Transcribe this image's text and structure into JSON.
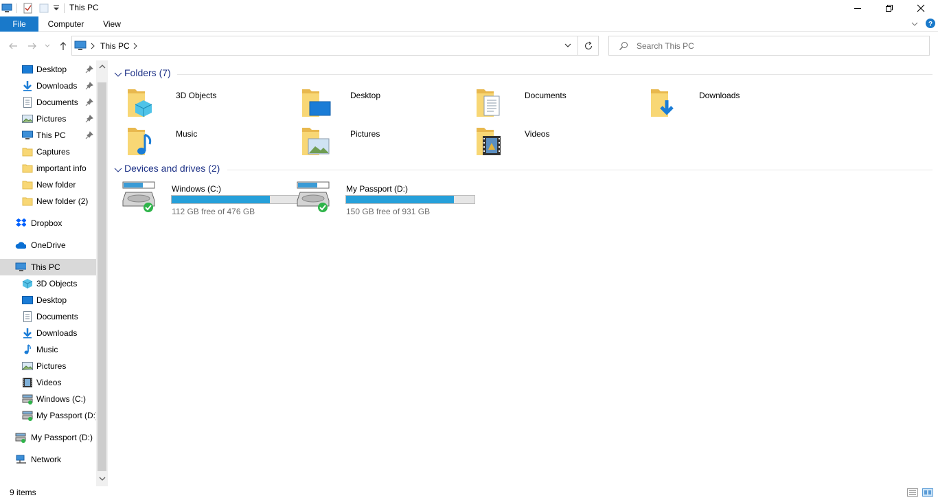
{
  "window": {
    "title": "This PC"
  },
  "ribbon": {
    "tabs": [
      {
        "label": "File"
      },
      {
        "label": "Computer"
      },
      {
        "label": "View"
      }
    ]
  },
  "address": {
    "segments": [
      "This PC"
    ]
  },
  "search": {
    "placeholder": "Search This PC"
  },
  "sidebar": {
    "quick_access": [
      {
        "label": "Desktop",
        "icon": "desktop-icon",
        "pinned": true
      },
      {
        "label": "Downloads",
        "icon": "downloads-icon",
        "pinned": true
      },
      {
        "label": "Documents",
        "icon": "documents-icon",
        "pinned": true
      },
      {
        "label": "Pictures",
        "icon": "pictures-icon",
        "pinned": true
      },
      {
        "label": "This PC",
        "icon": "computer-icon",
        "pinned": true
      },
      {
        "label": "Captures",
        "icon": "folder-icon",
        "pinned": false
      },
      {
        "label": "important info",
        "icon": "folder-icon",
        "pinned": false
      },
      {
        "label": "New folder",
        "icon": "folder-icon",
        "pinned": false
      },
      {
        "label": "New folder (2)",
        "icon": "folder-icon",
        "pinned": false
      }
    ],
    "dropbox": "Dropbox",
    "onedrive": "OneDrive",
    "this_pc": "This PC",
    "this_pc_children": [
      {
        "label": "3D Objects",
        "icon": "3d-objects-icon"
      },
      {
        "label": "Desktop",
        "icon": "desktop-icon"
      },
      {
        "label": "Documents",
        "icon": "documents-icon"
      },
      {
        "label": "Downloads",
        "icon": "downloads-icon"
      },
      {
        "label": "Music",
        "icon": "music-icon"
      },
      {
        "label": "Pictures",
        "icon": "pictures-icon"
      },
      {
        "label": "Videos",
        "icon": "videos-icon"
      },
      {
        "label": "Windows (C:)",
        "icon": "drive-icon"
      },
      {
        "label": "My Passport (D:)",
        "icon": "drive-icon"
      }
    ],
    "my_passport": "My Passport (D:)",
    "network": "Network"
  },
  "main": {
    "folders_header": "Folders (7)",
    "folders": [
      {
        "label": "3D Objects",
        "icon": "3d-objects-folder-icon"
      },
      {
        "label": "Desktop",
        "icon": "desktop-folder-icon"
      },
      {
        "label": "Documents",
        "icon": "documents-folder-icon"
      },
      {
        "label": "Downloads",
        "icon": "downloads-folder-icon"
      },
      {
        "label": "Music",
        "icon": "music-folder-icon"
      },
      {
        "label": "Pictures",
        "icon": "pictures-folder-icon"
      },
      {
        "label": "Videos",
        "icon": "videos-folder-icon"
      }
    ],
    "drives_header": "Devices and drives (2)",
    "drives": [
      {
        "label": "Windows (C:)",
        "free_text": "112 GB free of 476 GB",
        "used_fraction": 0.765
      },
      {
        "label": "My Passport (D:)",
        "free_text": "150 GB free of 931 GB",
        "used_fraction": 0.839
      }
    ]
  },
  "status": {
    "item_count": "9 items"
  },
  "colors": {
    "accent": "#1979ca",
    "header_text": "#1e3287",
    "drive_bar": "#26a0da"
  }
}
